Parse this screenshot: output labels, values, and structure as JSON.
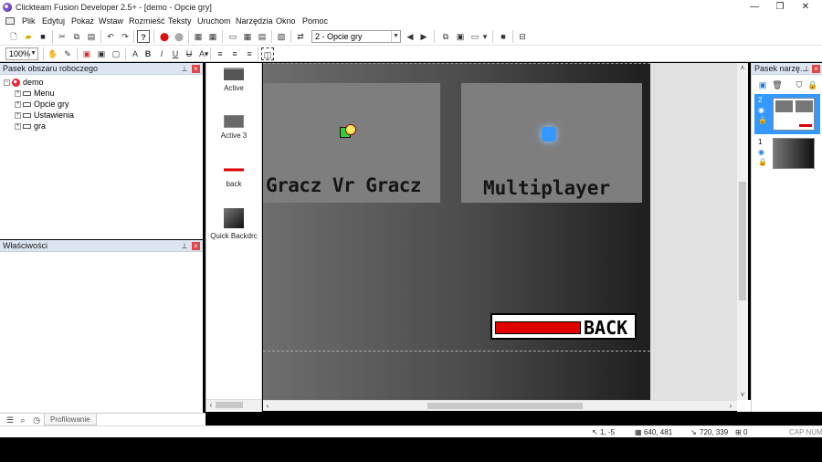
{
  "window": {
    "title": "Clickteam Fusion Developer 2.5+ - [demo - Opcie gry]",
    "controls": {
      "minimize": "—",
      "restore": "❐",
      "close": "✕"
    }
  },
  "menu": [
    "Plik",
    "Edytuj",
    "Pokaż",
    "Wstaw",
    "Rozmieść",
    "Teksty",
    "Uruchom",
    "Narzędzia",
    "Okno",
    "Pomoc"
  ],
  "toolbar": {
    "frame_select": "2 - Opcie gry",
    "zoom": "100%"
  },
  "workspace_panel": {
    "title": "Pasek obszaru roboczego",
    "tree": [
      {
        "label": "demo",
        "level": 0
      },
      {
        "label": "Menu",
        "level": 1
      },
      {
        "label": "Opcie gry",
        "level": 1
      },
      {
        "label": "Ustawienia",
        "level": 1
      },
      {
        "label": "gra",
        "level": 1
      }
    ]
  },
  "properties_panel": {
    "title": "Właściwości"
  },
  "bottom_tabs": {
    "profiling": "Profilowanie"
  },
  "objects": [
    {
      "label": "Active"
    },
    {
      "label": "Active 3"
    },
    {
      "label": "back"
    },
    {
      "label": "Quick Backdrc"
    }
  ],
  "frame": {
    "tile_left_text": "Gracz Vr Gracz",
    "tile_right_text": "Multiplayer",
    "back_button_text": "BACK"
  },
  "layers_panel": {
    "title": "Pasek narzę...",
    "layers": [
      {
        "number": "2"
      },
      {
        "number": "1"
      }
    ]
  },
  "status": {
    "cursor": "1, -5",
    "size": "640, 481",
    "position": "720, 339",
    "selected": "0",
    "keys": "CAP NUM"
  },
  "colors": {
    "accent": "#3399ff",
    "back_bar": "#e00000",
    "panel_header": "#dbe6f2"
  }
}
